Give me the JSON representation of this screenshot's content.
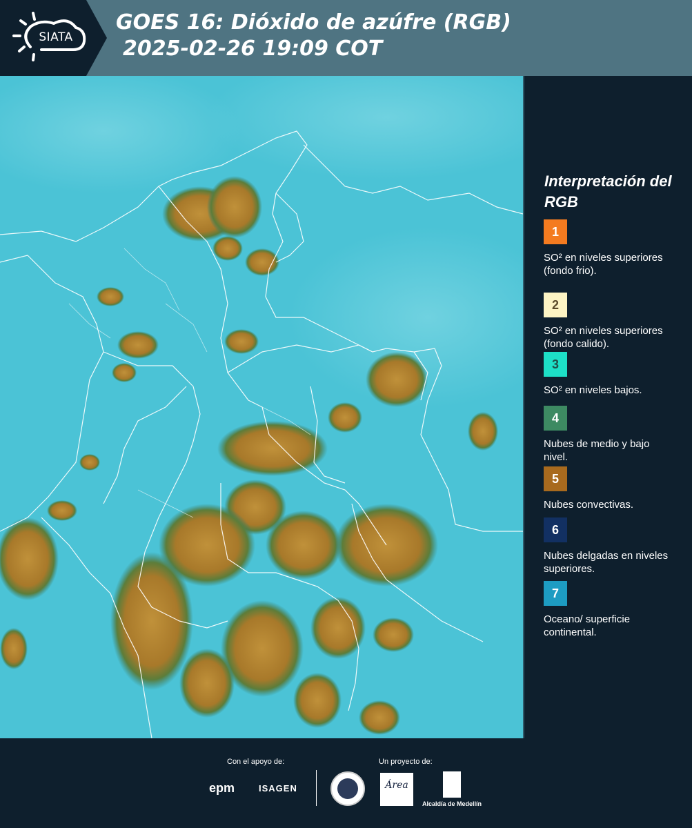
{
  "header": {
    "logo_text": "SIATA",
    "title": "GOES 16: Dióxido de azúfre (RGB)",
    "subtitle": "2025-02-26 19:09 COT"
  },
  "legend": {
    "title": "Interpretación del RGB",
    "items": [
      {
        "num": "1",
        "label": "SO² en niveles superiores (fondo frio).",
        "color": "#f47b20",
        "num_color": "#ffffff"
      },
      {
        "num": "2",
        "label": "SO² en niveles superiores (fondo calido).",
        "color": "#fdf4c4",
        "num_color": "#5a4a2a"
      },
      {
        "num": "3",
        "label": "SO² en niveles bajos.",
        "color": "#1de0c7",
        "num_color": "#20504a"
      },
      {
        "num": "4",
        "label": "Nubes de medio y bajo nivel.",
        "color": "#3d8a62",
        "num_color": "#ffffff"
      },
      {
        "num": "5",
        "label": "Nubes convectivas.",
        "color": "#a86a1e",
        "num_color": "#ffffff"
      },
      {
        "num": "6",
        "label": "Nubes delgadas en niveles superiores.",
        "color": "#123062",
        "num_color": "#ffffff"
      },
      {
        "num": "7",
        "label": "Oceano/ superficie continental.",
        "color": "#1d9cc2",
        "num_color": "#ffffff"
      }
    ]
  },
  "footer": {
    "support_label": "Con el apoyo de:",
    "project_label": "Un proyecto de:",
    "epm": "epm",
    "isagen": "ISAGEN",
    "area_label": "Área",
    "alcaldia": "Alcaldía de Medellín"
  },
  "colors": {
    "header_bg": "#4f7482",
    "page_bg": "#0e1f2d",
    "map_ocean": "#4bc3d6",
    "map_cloud": "#b07f2e"
  }
}
